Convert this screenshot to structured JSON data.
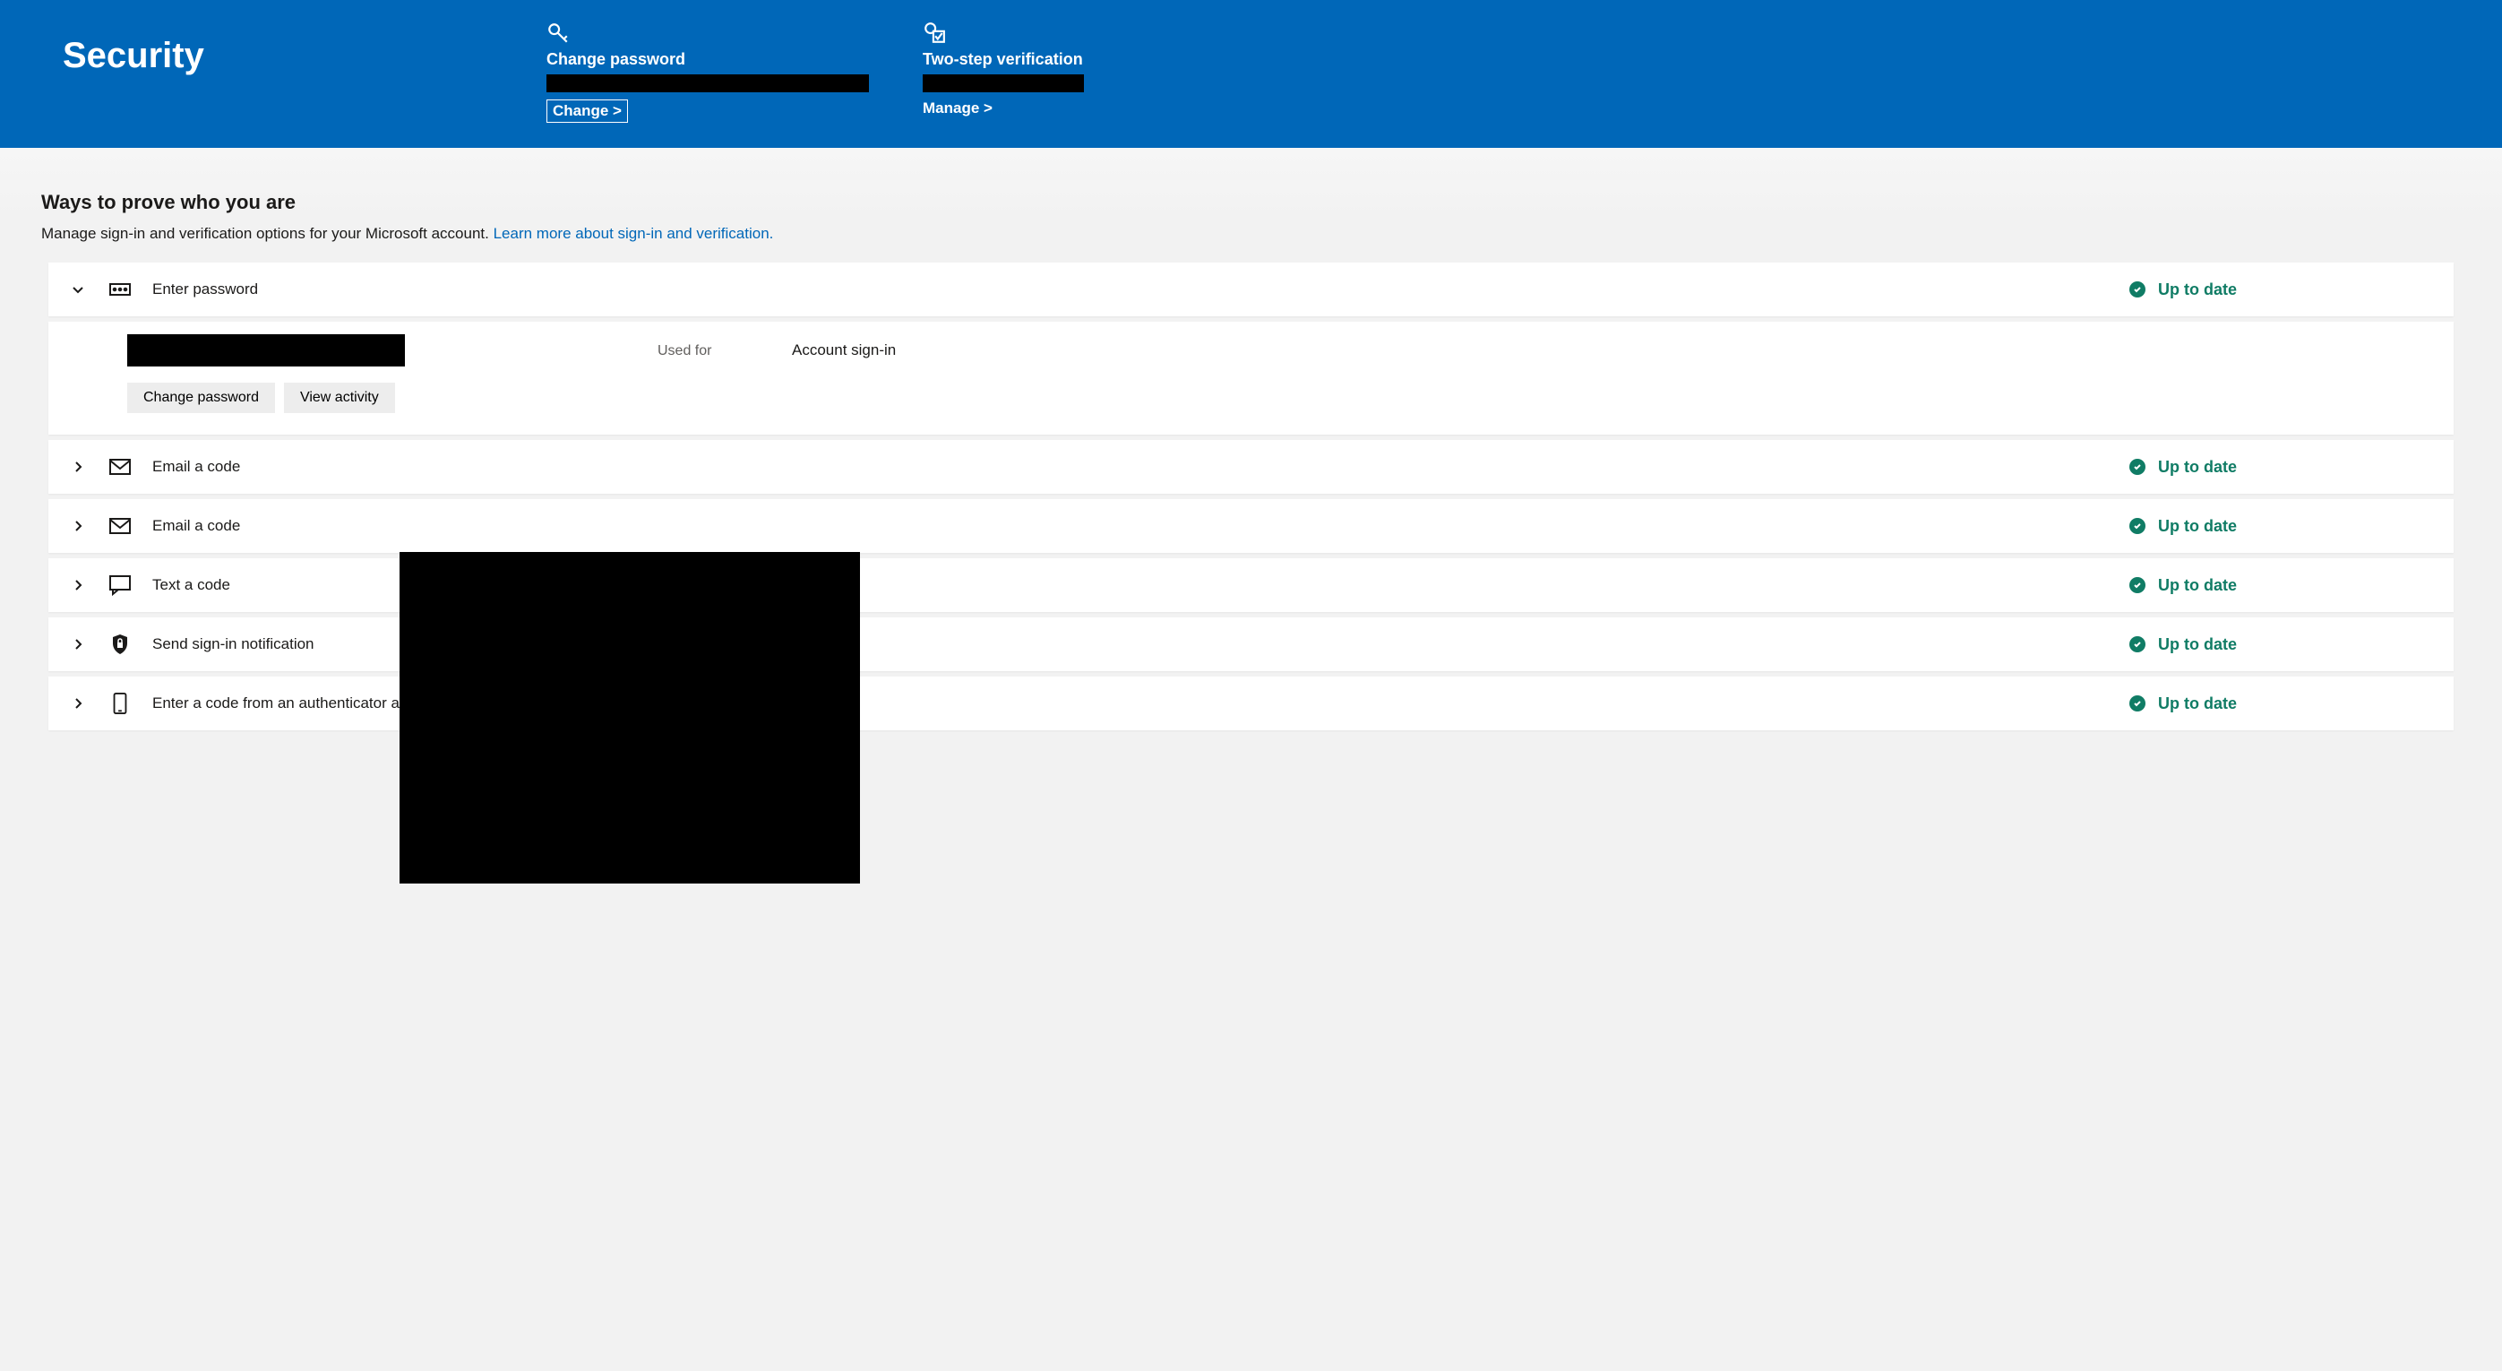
{
  "header": {
    "title": "Security",
    "cards": [
      {
        "title": "Change password",
        "link_label": "Change >"
      },
      {
        "title": "Two-step verification",
        "link_label": "Manage >"
      }
    ]
  },
  "section": {
    "title": "Ways to prove who you are",
    "desc_prefix": "Manage sign-in and verification options for your Microsoft account. ",
    "desc_link": "Learn more about sign-in and verification."
  },
  "expanded": {
    "used_for_label": "Used for",
    "used_for_value": "Account sign-in",
    "buttons": {
      "change_password": "Change password",
      "view_activity": "View activity"
    }
  },
  "status_label": "Up to date",
  "rows": [
    {
      "icon": "password",
      "label": "Enter password",
      "expanded": true
    },
    {
      "icon": "mail",
      "label": "Email a code",
      "expanded": false
    },
    {
      "icon": "mail",
      "label": "Email a code",
      "expanded": false
    },
    {
      "icon": "sms",
      "label": "Text a code",
      "expanded": false
    },
    {
      "icon": "shield",
      "label": "Send sign-in notification",
      "expanded": false
    },
    {
      "icon": "phone",
      "label": "Enter a code from an authenticator app",
      "expanded": false
    }
  ]
}
